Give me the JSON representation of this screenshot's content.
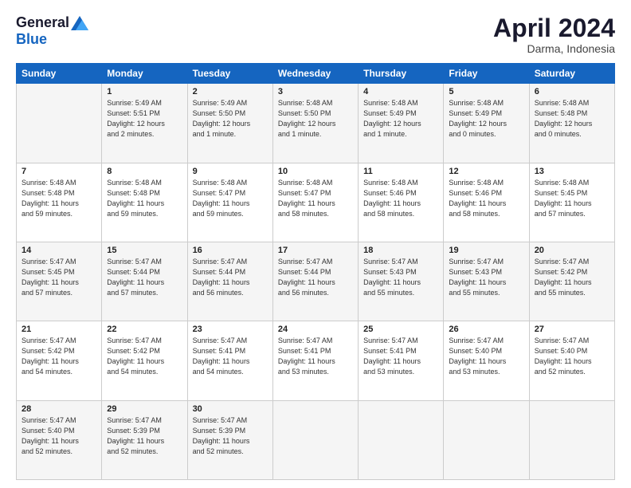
{
  "logo": {
    "general": "General",
    "blue": "Blue"
  },
  "title": "April 2024",
  "location": "Darma, Indonesia",
  "days_header": [
    "Sunday",
    "Monday",
    "Tuesday",
    "Wednesday",
    "Thursday",
    "Friday",
    "Saturday"
  ],
  "weeks": [
    [
      {
        "day": "",
        "info": ""
      },
      {
        "day": "1",
        "info": "Sunrise: 5:49 AM\nSunset: 5:51 PM\nDaylight: 12 hours\nand 2 minutes."
      },
      {
        "day": "2",
        "info": "Sunrise: 5:49 AM\nSunset: 5:50 PM\nDaylight: 12 hours\nand 1 minute."
      },
      {
        "day": "3",
        "info": "Sunrise: 5:48 AM\nSunset: 5:50 PM\nDaylight: 12 hours\nand 1 minute."
      },
      {
        "day": "4",
        "info": "Sunrise: 5:48 AM\nSunset: 5:49 PM\nDaylight: 12 hours\nand 1 minute."
      },
      {
        "day": "5",
        "info": "Sunrise: 5:48 AM\nSunset: 5:49 PM\nDaylight: 12 hours\nand 0 minutes."
      },
      {
        "day": "6",
        "info": "Sunrise: 5:48 AM\nSunset: 5:48 PM\nDaylight: 12 hours\nand 0 minutes."
      }
    ],
    [
      {
        "day": "7",
        "info": "Sunrise: 5:48 AM\nSunset: 5:48 PM\nDaylight: 11 hours\nand 59 minutes."
      },
      {
        "day": "8",
        "info": "Sunrise: 5:48 AM\nSunset: 5:48 PM\nDaylight: 11 hours\nand 59 minutes."
      },
      {
        "day": "9",
        "info": "Sunrise: 5:48 AM\nSunset: 5:47 PM\nDaylight: 11 hours\nand 59 minutes."
      },
      {
        "day": "10",
        "info": "Sunrise: 5:48 AM\nSunset: 5:47 PM\nDaylight: 11 hours\nand 58 minutes."
      },
      {
        "day": "11",
        "info": "Sunrise: 5:48 AM\nSunset: 5:46 PM\nDaylight: 11 hours\nand 58 minutes."
      },
      {
        "day": "12",
        "info": "Sunrise: 5:48 AM\nSunset: 5:46 PM\nDaylight: 11 hours\nand 58 minutes."
      },
      {
        "day": "13",
        "info": "Sunrise: 5:48 AM\nSunset: 5:45 PM\nDaylight: 11 hours\nand 57 minutes."
      }
    ],
    [
      {
        "day": "14",
        "info": "Sunrise: 5:47 AM\nSunset: 5:45 PM\nDaylight: 11 hours\nand 57 minutes."
      },
      {
        "day": "15",
        "info": "Sunrise: 5:47 AM\nSunset: 5:44 PM\nDaylight: 11 hours\nand 57 minutes."
      },
      {
        "day": "16",
        "info": "Sunrise: 5:47 AM\nSunset: 5:44 PM\nDaylight: 11 hours\nand 56 minutes."
      },
      {
        "day": "17",
        "info": "Sunrise: 5:47 AM\nSunset: 5:44 PM\nDaylight: 11 hours\nand 56 minutes."
      },
      {
        "day": "18",
        "info": "Sunrise: 5:47 AM\nSunset: 5:43 PM\nDaylight: 11 hours\nand 55 minutes."
      },
      {
        "day": "19",
        "info": "Sunrise: 5:47 AM\nSunset: 5:43 PM\nDaylight: 11 hours\nand 55 minutes."
      },
      {
        "day": "20",
        "info": "Sunrise: 5:47 AM\nSunset: 5:42 PM\nDaylight: 11 hours\nand 55 minutes."
      }
    ],
    [
      {
        "day": "21",
        "info": "Sunrise: 5:47 AM\nSunset: 5:42 PM\nDaylight: 11 hours\nand 54 minutes."
      },
      {
        "day": "22",
        "info": "Sunrise: 5:47 AM\nSunset: 5:42 PM\nDaylight: 11 hours\nand 54 minutes."
      },
      {
        "day": "23",
        "info": "Sunrise: 5:47 AM\nSunset: 5:41 PM\nDaylight: 11 hours\nand 54 minutes."
      },
      {
        "day": "24",
        "info": "Sunrise: 5:47 AM\nSunset: 5:41 PM\nDaylight: 11 hours\nand 53 minutes."
      },
      {
        "day": "25",
        "info": "Sunrise: 5:47 AM\nSunset: 5:41 PM\nDaylight: 11 hours\nand 53 minutes."
      },
      {
        "day": "26",
        "info": "Sunrise: 5:47 AM\nSunset: 5:40 PM\nDaylight: 11 hours\nand 53 minutes."
      },
      {
        "day": "27",
        "info": "Sunrise: 5:47 AM\nSunset: 5:40 PM\nDaylight: 11 hours\nand 52 minutes."
      }
    ],
    [
      {
        "day": "28",
        "info": "Sunrise: 5:47 AM\nSunset: 5:40 PM\nDaylight: 11 hours\nand 52 minutes."
      },
      {
        "day": "29",
        "info": "Sunrise: 5:47 AM\nSunset: 5:39 PM\nDaylight: 11 hours\nand 52 minutes."
      },
      {
        "day": "30",
        "info": "Sunrise: 5:47 AM\nSunset: 5:39 PM\nDaylight: 11 hours\nand 52 minutes."
      },
      {
        "day": "",
        "info": ""
      },
      {
        "day": "",
        "info": ""
      },
      {
        "day": "",
        "info": ""
      },
      {
        "day": "",
        "info": ""
      }
    ]
  ]
}
